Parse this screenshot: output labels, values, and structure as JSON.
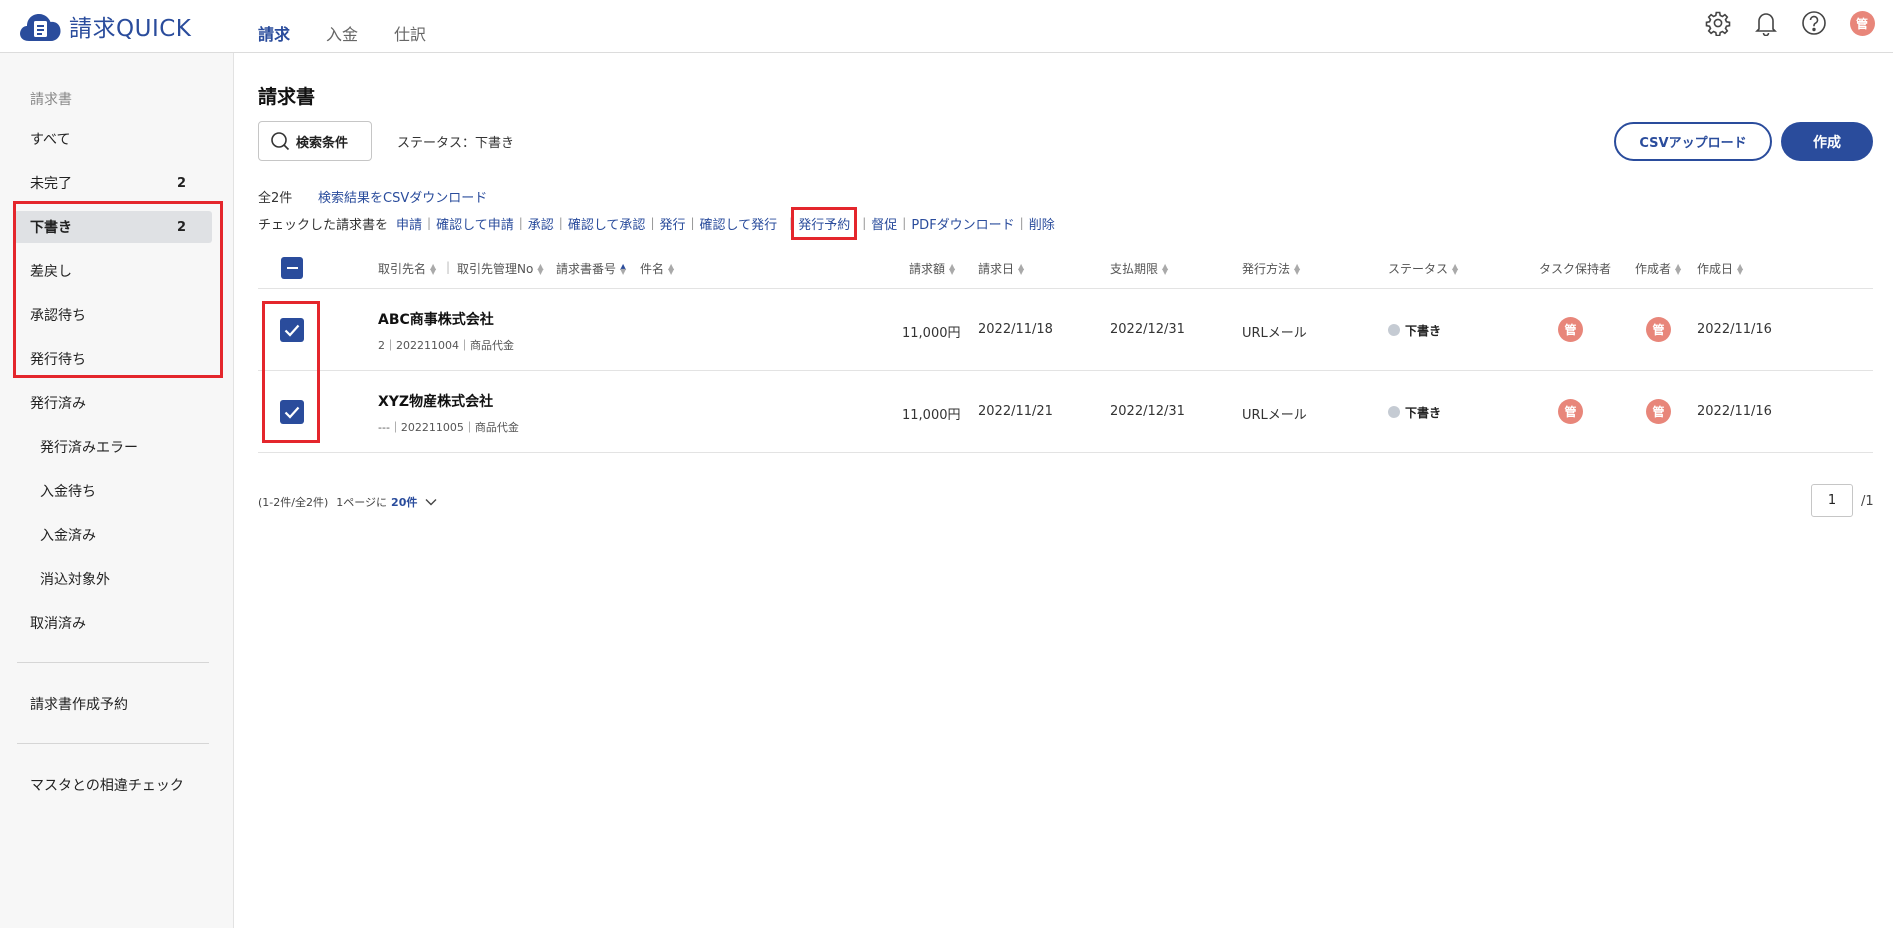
{
  "app": {
    "logo_text": "請求QUICK"
  },
  "header": {
    "tabs": [
      {
        "label": "請求",
        "active": true
      },
      {
        "label": "入金",
        "active": false
      },
      {
        "label": "仕訳",
        "active": false
      }
    ],
    "icons": [
      "gear-icon",
      "bell-icon",
      "help-icon",
      "user-avatar"
    ],
    "user_avatar": "管"
  },
  "sidebar": {
    "heading": "請求書",
    "items": [
      {
        "label": "すべて",
        "count": ""
      },
      {
        "label": "未完了",
        "count": "2"
      },
      {
        "label": "下書き",
        "count": "2",
        "selected": true
      },
      {
        "label": "差戻し",
        "count": ""
      },
      {
        "label": "承認待ち",
        "count": ""
      },
      {
        "label": "発行待ち",
        "count": ""
      },
      {
        "label": "発行済み",
        "count": ""
      },
      {
        "label": "発行済みエラー",
        "count": ""
      },
      {
        "label": "入金待ち",
        "count": ""
      },
      {
        "label": "入金済み",
        "count": ""
      },
      {
        "label": "消込対象外",
        "count": ""
      },
      {
        "label": "取消済み",
        "count": ""
      }
    ],
    "reservation": "請求書作成予約",
    "master_check": "マスタとの相違チェック"
  },
  "main": {
    "title": "請求書",
    "search_button": "検索条件",
    "status_filter": "ステータス：下書き",
    "csv_upload": "CSVアップロード",
    "create": "作成",
    "total": "全2件",
    "csv_download": "検索結果をCSVダウンロード",
    "action_prefix": "チェックした請求書を",
    "actions": [
      "申請",
      "確認して申請",
      "承認",
      "確認して承認",
      "発行",
      "確認して発行",
      "発行予約",
      "督促",
      "PDFダウンロード",
      "削除"
    ],
    "highlighted_action": "発行予約"
  },
  "table": {
    "headers": {
      "client": "取引先名",
      "client_no": "取引先管理No",
      "invoice_no": "請求書番号",
      "subject": "件名",
      "amount": "請求額",
      "invoice_date": "請求日",
      "due": "支払期限",
      "method": "発行方法",
      "status": "ステータス",
      "task_holder": "タスク保持者",
      "creator": "作成者",
      "created": "作成日"
    },
    "rows": [
      {
        "client": "ABC商事株式会社",
        "sub": "2｜202211004｜商品代金",
        "amount": "11,000円",
        "invoice_date": "2022/11/18",
        "due": "2022/12/31",
        "method": "URLメール",
        "status": "下書き",
        "task_holder": "管",
        "creator": "管",
        "created": "2022/11/16",
        "checked": true
      },
      {
        "client": "XYZ物産株式会社",
        "sub": "---｜202211005｜商品代金",
        "amount": "11,000円",
        "invoice_date": "2022/11/21",
        "due": "2022/12/31",
        "method": "URLメール",
        "status": "下書き",
        "task_holder": "管",
        "creator": "管",
        "created": "2022/11/16",
        "checked": true
      }
    ]
  },
  "pagination": {
    "range": "(1-2件/全2件)",
    "per_page_prefix": "1ページに",
    "per_page": "20件",
    "current_page": "1",
    "total_pages": "/1"
  },
  "colors": {
    "brand": "#2a4c9c",
    "highlight": "#e4262c",
    "avatar": "#e8867a"
  }
}
